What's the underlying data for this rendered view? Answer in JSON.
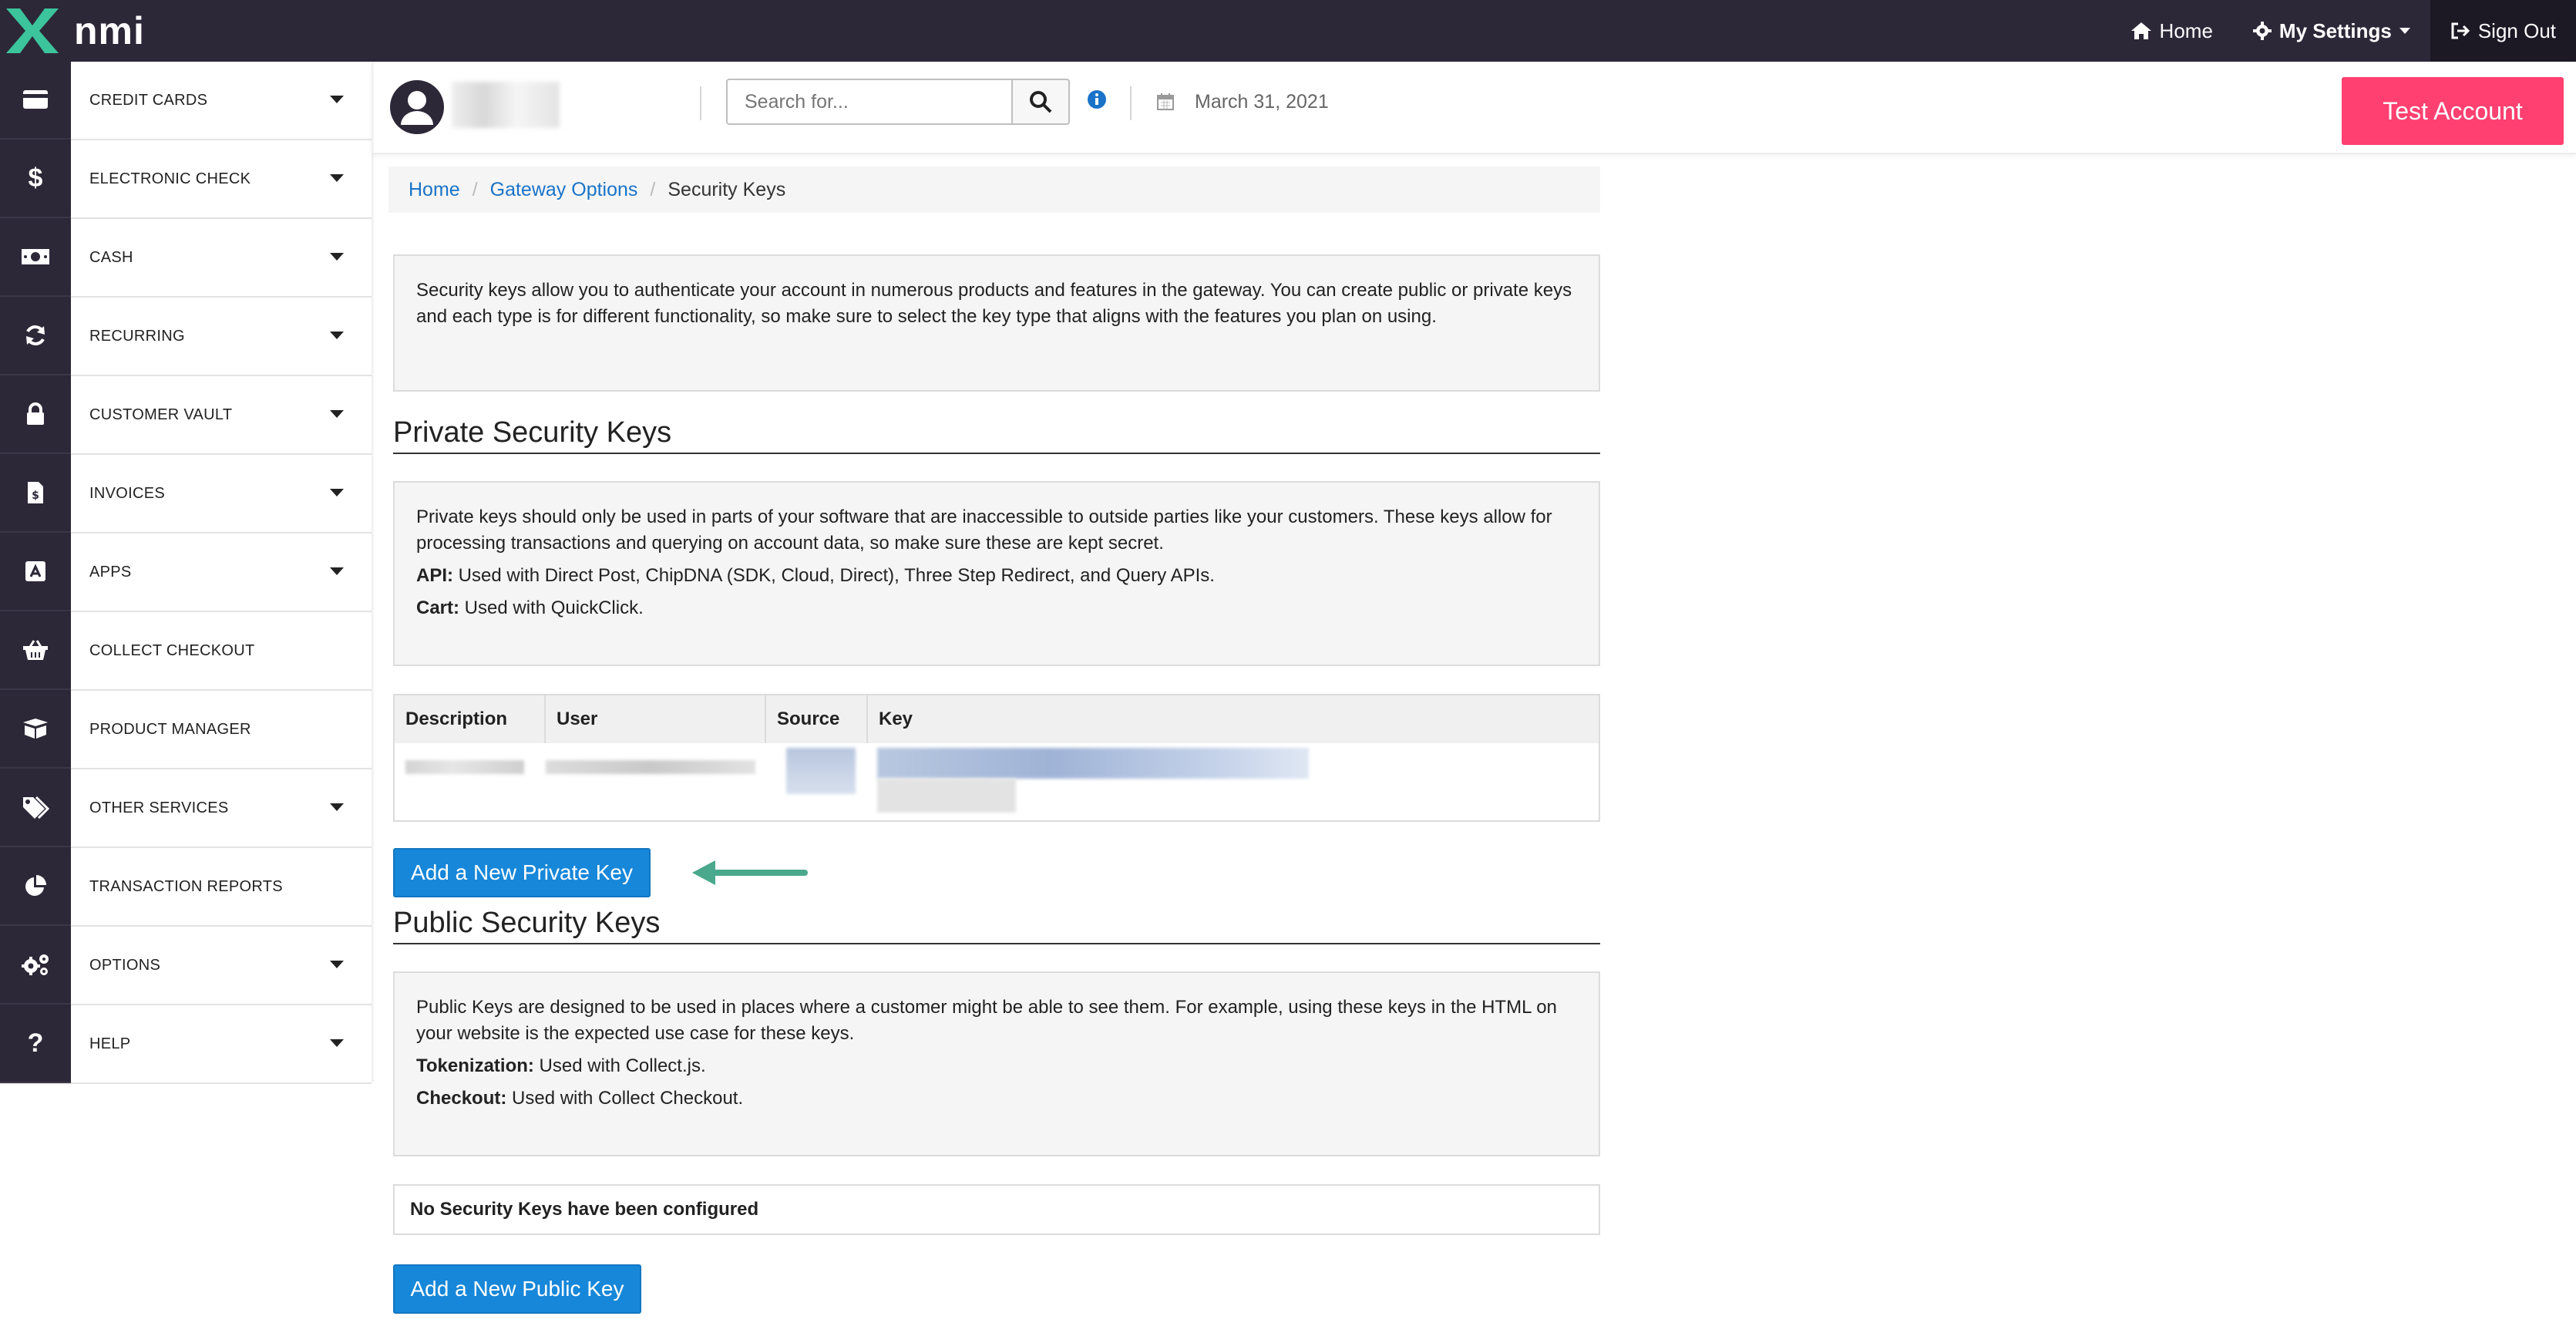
{
  "brand": {
    "name": "nmi",
    "accent_green": "#3cc49c",
    "topbar_color": "#2d2838",
    "sidebar_icon_bg": "#2d2838"
  },
  "topnav": {
    "home_label": "Home",
    "settings_label": "My Settings",
    "signout_label": "Sign Out"
  },
  "sidebar": {
    "items": [
      {
        "label": "CREDIT CARDS",
        "icon": "credit-card-icon",
        "has_caret": true
      },
      {
        "label": "ELECTRONIC CHECK",
        "icon": "dollar-icon",
        "has_caret": true
      },
      {
        "label": "CASH",
        "icon": "cash-icon",
        "has_caret": true
      },
      {
        "label": "RECURRING",
        "icon": "refresh-icon",
        "has_caret": true
      },
      {
        "label": "CUSTOMER VAULT",
        "icon": "lock-icon",
        "has_caret": true
      },
      {
        "label": "INVOICES",
        "icon": "invoice-icon",
        "has_caret": true
      },
      {
        "label": "APPS",
        "icon": "app-store-icon",
        "has_caret": true
      },
      {
        "label": "COLLECT CHECKOUT",
        "icon": "basket-icon",
        "has_caret": false
      },
      {
        "label": "PRODUCT MANAGER",
        "icon": "box-icon",
        "has_caret": false
      },
      {
        "label": "OTHER SERVICES",
        "icon": "tags-icon",
        "has_caret": true
      },
      {
        "label": "TRANSACTION REPORTS",
        "icon": "pie-chart-icon",
        "has_caret": false
      },
      {
        "label": "OPTIONS",
        "icon": "gears-icon",
        "has_caret": true
      },
      {
        "label": "HELP",
        "icon": "question-icon",
        "has_caret": true
      }
    ]
  },
  "header": {
    "search_placeholder": "Search for...",
    "date": "March 31, 2021",
    "test_account_label": "Test Account",
    "test_account_color": "#ff4070"
  },
  "breadcrumb": {
    "home": "Home",
    "gateway_options": "Gateway Options",
    "current": "Security Keys"
  },
  "intro_text": "Security keys allow you to authenticate your account in numerous products and features in the gateway. You can create public or private keys and each type is for different functionality, so make sure to select the key type that aligns with the features you plan on using.",
  "private": {
    "title": "Private Security Keys",
    "description": "Private keys should only be used in parts of your software that are inaccessible to outside parties like your customers. These keys allow for processing transactions and querying on account data, so make sure these are kept secret.",
    "api_label": "API:",
    "api_text": " Used with Direct Post, ChipDNA (SDK, Cloud, Direct), Three Step Redirect, and Query APIs.",
    "cart_label": "Cart:",
    "cart_text": " Used with QuickClick.",
    "table_headers": [
      "Description",
      "User",
      "Source",
      "Key"
    ],
    "add_button": "Add a New Private Key"
  },
  "public": {
    "title": "Public Security Keys",
    "description": "Public Keys are designed to be used in places where a customer might be able to see them. For example, using these keys in the HTML on your website is the expected use case for these keys.",
    "tokenization_label": "Tokenization:",
    "tokenization_text": " Used with Collect.js.",
    "checkout_label": "Checkout:",
    "checkout_text": " Used with Collect Checkout.",
    "empty_message": "No Security Keys have been configured",
    "add_button": "Add a New Public Key"
  },
  "colors": {
    "link": "#1a73c8",
    "button_blue": "#1787d9",
    "arrow": "#4aa88c"
  }
}
